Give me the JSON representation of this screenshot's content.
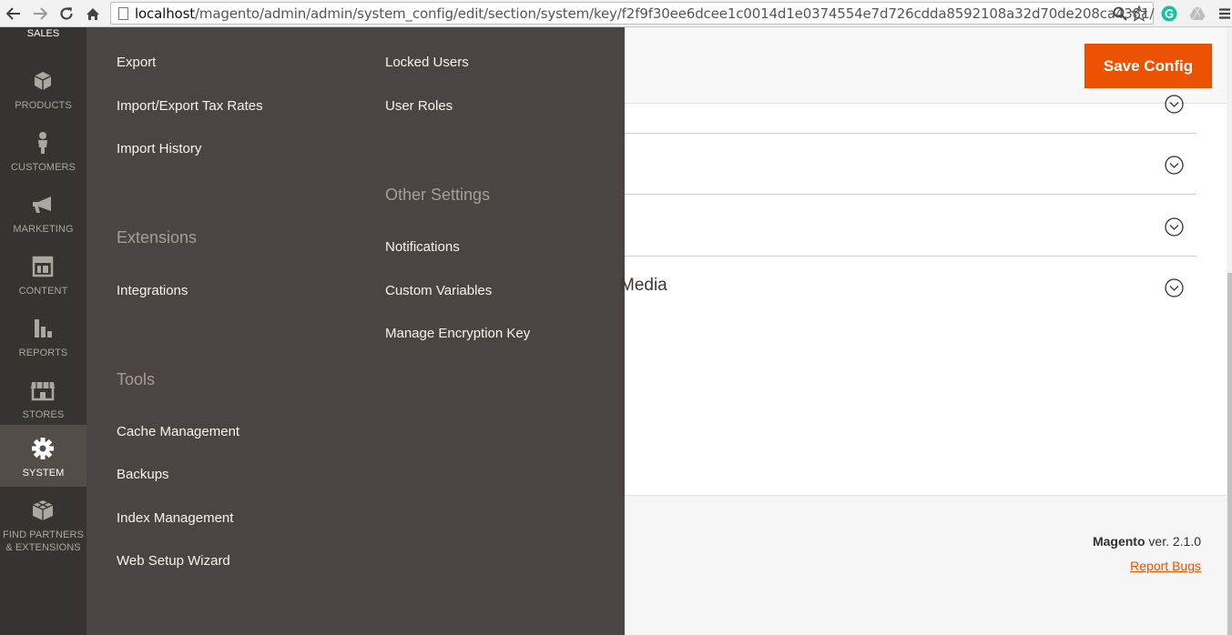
{
  "browser": {
    "url_host": "localhost",
    "url_path": "/magento/admin/admin/system_config/edit/section/system/key/f2f9f30ee6dcee1c0014d1e0374554e7d726cdda8592108a32d70de208ca4381/"
  },
  "sidebar": {
    "sales_label": "SALES",
    "items": [
      {
        "label": "PRODUCTS",
        "icon": "cube-icon"
      },
      {
        "label": "CUSTOMERS",
        "icon": "person-icon"
      },
      {
        "label": "MARKETING",
        "icon": "megaphone-icon"
      },
      {
        "label": "CONTENT",
        "icon": "layout-icon"
      },
      {
        "label": "REPORTS",
        "icon": "bar-chart-icon"
      },
      {
        "label": "STORES",
        "icon": "storefront-icon"
      },
      {
        "label": "SYSTEM",
        "icon": "gear-icon",
        "active": true
      },
      {
        "label": "FIND PARTNERS",
        "label2": "& EXTENSIONS",
        "icon": "blocks-icon"
      }
    ]
  },
  "flyout": {
    "col1": {
      "export": "Export",
      "import_export_tax": "Import/Export Tax Rates",
      "import_history": "Import History",
      "extensions_heading": "Extensions",
      "integrations": "Integrations",
      "tools_heading": "Tools",
      "cache_management": "Cache Management",
      "backups": "Backups",
      "index_management": "Index Management",
      "web_setup_wizard": "Web Setup Wizard"
    },
    "col2": {
      "locked_users": "Locked Users",
      "user_roles": "User Roles",
      "other_settings_heading": "Other Settings",
      "notifications": "Notifications",
      "custom_variables": "Custom Variables",
      "manage_encryption_key": "Manage Encryption Key"
    }
  },
  "header": {
    "save_label": "Save Config"
  },
  "sections": {
    "media_title": "Media"
  },
  "footer": {
    "brand": "Magento",
    "version": " ver. 2.1.0",
    "report_bugs": "Report Bugs"
  },
  "colors": {
    "accent": "#eb5202",
    "sidebar_bg": "#373330",
    "flyout_bg": "#4a4542"
  }
}
